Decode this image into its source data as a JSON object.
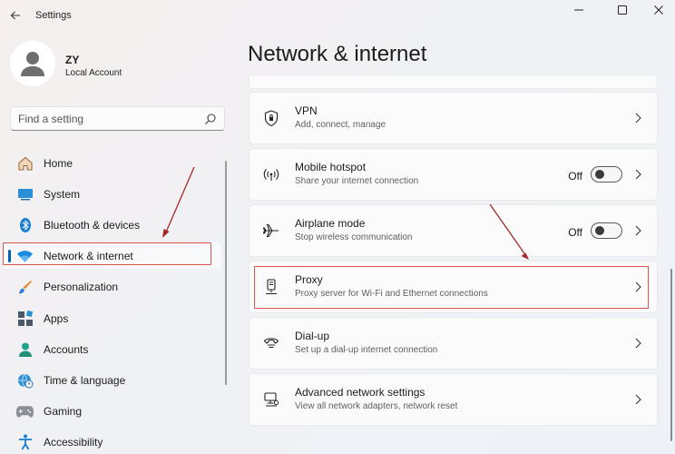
{
  "window": {
    "title": "Settings"
  },
  "profile": {
    "name": "ZY",
    "account_type": "Local Account"
  },
  "search": {
    "placeholder": "Find a setting"
  },
  "sidebar": {
    "items": [
      {
        "label": "Home",
        "icon": "home-icon"
      },
      {
        "label": "System",
        "icon": "monitor-icon"
      },
      {
        "label": "Bluetooth & devices",
        "icon": "bluetooth-icon"
      },
      {
        "label": "Network & internet",
        "icon": "wifi-icon",
        "active": true
      },
      {
        "label": "Personalization",
        "icon": "brush-icon"
      },
      {
        "label": "Apps",
        "icon": "apps-icon"
      },
      {
        "label": "Accounts",
        "icon": "person-icon"
      },
      {
        "label": "Time & language",
        "icon": "globe-clock-icon"
      },
      {
        "label": "Gaming",
        "icon": "gamepad-icon"
      },
      {
        "label": "Accessibility",
        "icon": "accessibility-icon"
      }
    ]
  },
  "main": {
    "title": "Network & internet",
    "cards": [
      {
        "title": "VPN",
        "subtitle": "Add, connect, manage",
        "icon": "shield-icon"
      },
      {
        "title": "Mobile hotspot",
        "subtitle": "Share your internet connection",
        "icon": "hotspot-icon",
        "toggle": "Off"
      },
      {
        "title": "Airplane mode",
        "subtitle": "Stop wireless communication",
        "icon": "airplane-icon",
        "toggle": "Off"
      },
      {
        "title": "Proxy",
        "subtitle": "Proxy server for Wi-Fi and Ethernet connections",
        "icon": "proxy-icon"
      },
      {
        "title": "Dial-up",
        "subtitle": "Set up a dial-up internet connection",
        "icon": "dialup-icon"
      },
      {
        "title": "Advanced network settings",
        "subtitle": "View all network adapters, network reset",
        "icon": "network-adapter-icon"
      }
    ]
  },
  "colors": {
    "accent": "#005fb8",
    "annotation": "#d9534f"
  }
}
